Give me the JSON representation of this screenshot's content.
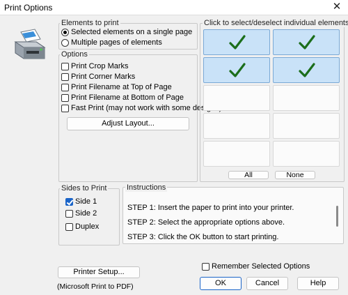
{
  "window": {
    "title": "Print Options",
    "close_glyph": "✕"
  },
  "elements_to_print": {
    "label": "Elements to print",
    "options": [
      {
        "label": "Selected elements on a single page",
        "checked": true
      },
      {
        "label": "Multiple pages of elements",
        "checked": false
      }
    ]
  },
  "options_group": {
    "label": "Options",
    "items": [
      {
        "label": "Print Crop Marks",
        "checked": false
      },
      {
        "label": "Print Corner Marks",
        "checked": false
      },
      {
        "label": "Print Filename at Top of Page",
        "checked": false
      },
      {
        "label": "Print Filename at Bottom of Page",
        "checked": false
      },
      {
        "label": "Fast Print (may not work with some designs)",
        "checked": false
      }
    ],
    "adjust_layout_label": "Adjust Layout..."
  },
  "element_grid": {
    "label": "Click to select/deselect individual elements",
    "cells": [
      {
        "selected": true
      },
      {
        "selected": true
      },
      {
        "selected": true
      },
      {
        "selected": true
      },
      {
        "selected": false
      },
      {
        "selected": false
      },
      {
        "selected": false
      },
      {
        "selected": false
      },
      {
        "selected": false
      },
      {
        "selected": false
      }
    ],
    "all_label": "All",
    "none_label": "None",
    "tick_color": "#1b6e1b",
    "selected_color": "#c9e2f8"
  },
  "sides_to_print": {
    "label": "Sides to Print",
    "items": [
      {
        "label": "Side 1",
        "checked": true
      },
      {
        "label": "Side 2",
        "checked": false
      },
      {
        "label": "Duplex",
        "checked": false
      }
    ]
  },
  "instructions": {
    "label": "Instructions",
    "lines": [
      "STEP 1: Insert the paper to print into your printer.",
      "STEP 2: Select the appropriate options above.",
      "STEP 3: Click the OK button to start printing."
    ]
  },
  "footer": {
    "printer_setup_label": "Printer Setup...",
    "printer_name": "(Microsoft Print to PDF)",
    "remember_label": "Remember Selected Options",
    "remember_checked": false,
    "ok_label": "OK",
    "cancel_label": "Cancel",
    "help_label": "Help"
  },
  "icons": {
    "printer": "printer-icon",
    "tick": "check-mark-icon"
  },
  "colors": {
    "accent": "#1a64c8"
  }
}
